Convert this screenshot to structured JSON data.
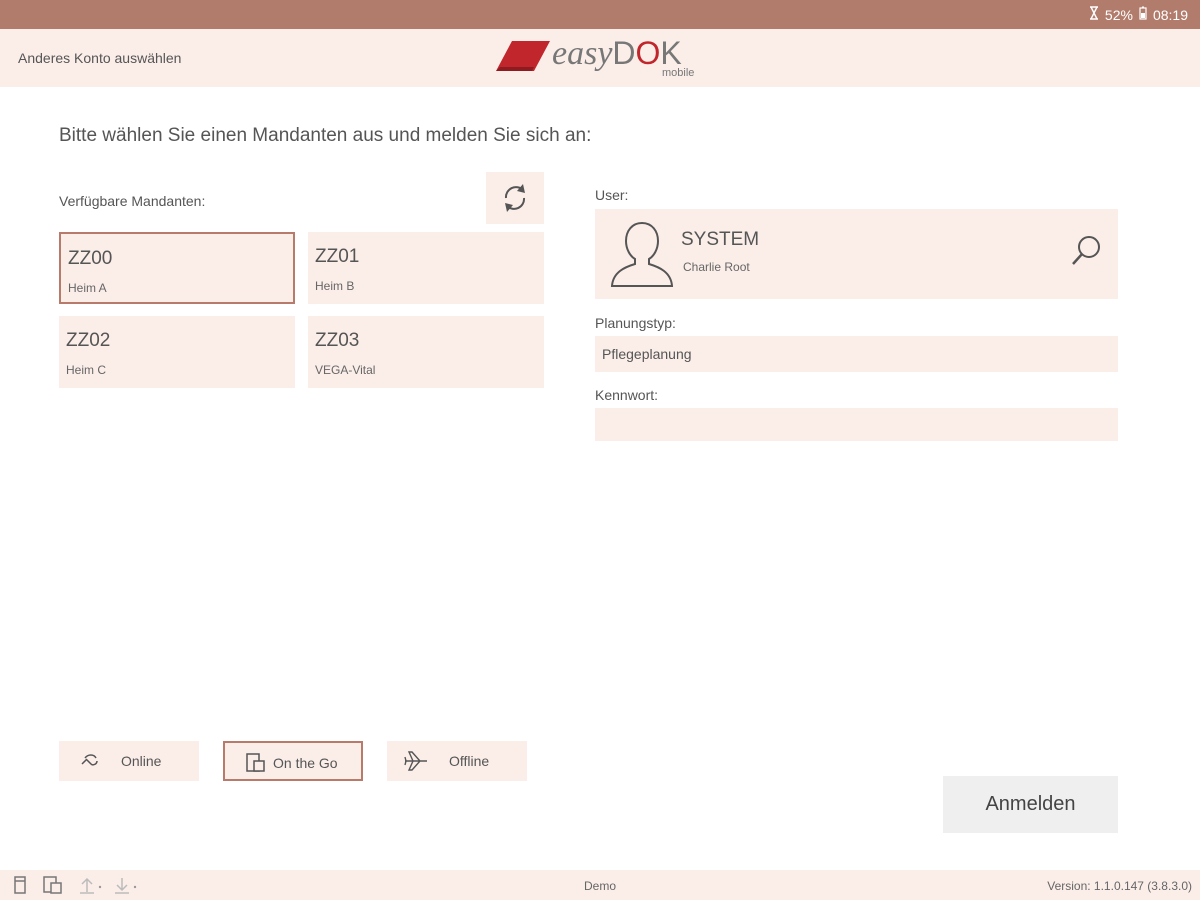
{
  "status_bar": {
    "battery": "52%",
    "time": "08:19"
  },
  "header": {
    "switch_account": "Anderes Konto auswählen",
    "logo_text_1": "easy",
    "logo_text_2": "D",
    "logo_text_3": "O",
    "logo_text_4": "K",
    "logo_sub": "mobile"
  },
  "main": {
    "prompt": "Bitte wählen Sie einen Mandanten aus und melden Sie sich an:",
    "clients_label": "Verfügbare Mandanten:",
    "clients": [
      {
        "code": "ZZ00",
        "name": "Heim A",
        "selected": true
      },
      {
        "code": "ZZ01",
        "name": "Heim B",
        "selected": false
      },
      {
        "code": "ZZ02",
        "name": "Heim C",
        "selected": false
      },
      {
        "code": "ZZ03",
        "name": "VEGA-Vital",
        "selected": false
      }
    ]
  },
  "form": {
    "user_label": "User:",
    "user_name": "SYSTEM",
    "user_full_name": "Charlie Root",
    "planning_type_label": "Planungstyp:",
    "planning_type_value": "Pflegeplanung",
    "password_label": "Kennwort:",
    "password_value": ""
  },
  "modes": {
    "online": "Online",
    "onthego": "On the Go",
    "offline": "Offline",
    "selected": "On the Go"
  },
  "login_button": "Anmelden",
  "footer": {
    "center": "Demo",
    "version": "Version:  1.1.0.147 (3.8.3.0)"
  },
  "colors": {
    "status_bar": "#b27c6c",
    "surface": "#fbeee9",
    "accent_border": "#b87a6a",
    "logo_red": "#c0262c"
  }
}
